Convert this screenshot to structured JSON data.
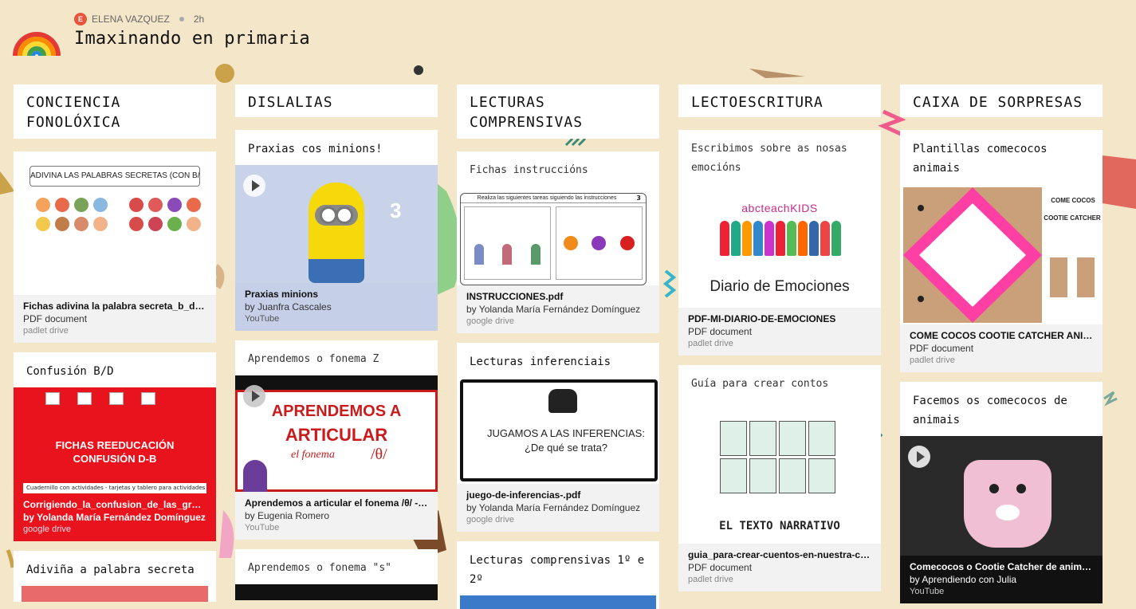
{
  "header": {
    "author_initial": "E",
    "author": "ELENA VAZQUEZ",
    "time": "2h",
    "title": "Imaxinando en primaria"
  },
  "columns": [
    {
      "title": "CONCIENCIA FONOLÓXICA",
      "cards": [
        {
          "thumb_text": "ADIVINA LAS PALABRAS SECRETAS (CON B/D)",
          "attach_title": "Fichas adivina la palabra secreta_b_d_E...",
          "attach_sub": "PDF document",
          "attach_src": "padlet drive"
        },
        {
          "title": "Confusión B/D",
          "thumb_line1": "FICHAS REEDUCACIÓN",
          "thumb_line2": "CONFUSIÓN D-B",
          "thumb_small": "Cuadernillo con actividades - tarjetas y tablero para actividades",
          "attach_title": "Corrigiendo_la_confusion_de_las_grafia...",
          "attach_sub": "by Yolanda María Fernández Domínguez",
          "attach_src": "google drive"
        },
        {
          "title": "Adiviña a palabra secreta"
        }
      ]
    },
    {
      "title": "DISLALIAS",
      "cards": [
        {
          "title": "Praxias cos minions!",
          "thumb_number": "3",
          "attach_title": "Praxias minions",
          "attach_sub": "by Juanfra Cascales",
          "attach_src": "YouTube"
        },
        {
          "title": "Aprendemos o fonema Z",
          "thumb_line1": "APRENDEMOS A",
          "thumb_line2": "ARTICULAR",
          "thumb_line3": "el fonema",
          "thumb_line4": "/θ/",
          "attach_title": "Aprendemos a articular el fonema /θ/ - ...",
          "attach_sub": "by Eugenia Romero",
          "attach_src": "YouTube"
        },
        {
          "title": "Aprendemos o fonema \"s\""
        }
      ]
    },
    {
      "title": "LECTURAS COMPRENSIVAS",
      "cards": [
        {
          "title": "Fichas instruccións",
          "thumb_header": "Realiza las siguientes tareas siguiendo las instrucciones",
          "thumb_page": "3",
          "attach_title": "INSTRUCCIONES.pdf",
          "attach_sub": "by Yolanda María Fernández Domínguez",
          "attach_src": "google drive"
        },
        {
          "title": "Lecturas inferenciais",
          "thumb_line1": "JUGAMOS A LAS INFERENCIAS:",
          "thumb_line2": "¿De qué se trata?",
          "attach_title": "juego-de-inferencias-.pdf",
          "attach_sub": "by Yolanda María Fernández Domínguez",
          "attach_src": "google drive"
        },
        {
          "title": "Lecturas comprensivas 1º e 2º"
        }
      ]
    },
    {
      "title": "LECTOESCRITURA",
      "cards": [
        {
          "title": "Escribimos sobre as nosas emocións",
          "thumb_brand": "abcteachKIDS",
          "thumb_caption": "Diario de Emociones",
          "attach_title": "PDF-MI-DIARIO-DE-EMOCIONES",
          "attach_sub": "PDF document",
          "attach_src": "padlet drive"
        },
        {
          "title": "Guía para crear contos",
          "thumb_caption": "EL TEXTO NARRATIVO",
          "attach_title": "guia_para-crear-cuentos-en-nuestra-clase",
          "attach_sub": "PDF document",
          "attach_src": "padlet drive"
        }
      ]
    },
    {
      "title": "CAIXA DE SORPRESAS",
      "cards": [
        {
          "title": "Plantillas comecocos animais",
          "thumb_line1": "COME COCOS",
          "thumb_line2": "COOTIE CATCHER",
          "attach_title": "COME COCOS COOTIE CATCHER ANIMA...",
          "attach_sub": "PDF document",
          "attach_src": "padlet drive"
        },
        {
          "title": "Facemos os comecocos de animais",
          "attach_title": "Comecocos o Cootie Catcher de animal...",
          "attach_sub": "by Aprendiendo con Julia",
          "attach_src": "YouTube"
        }
      ]
    }
  ],
  "colors": {
    "background": "#f3e6c9",
    "red_attachment": "#e8131c",
    "avatar": "#e8553a"
  }
}
